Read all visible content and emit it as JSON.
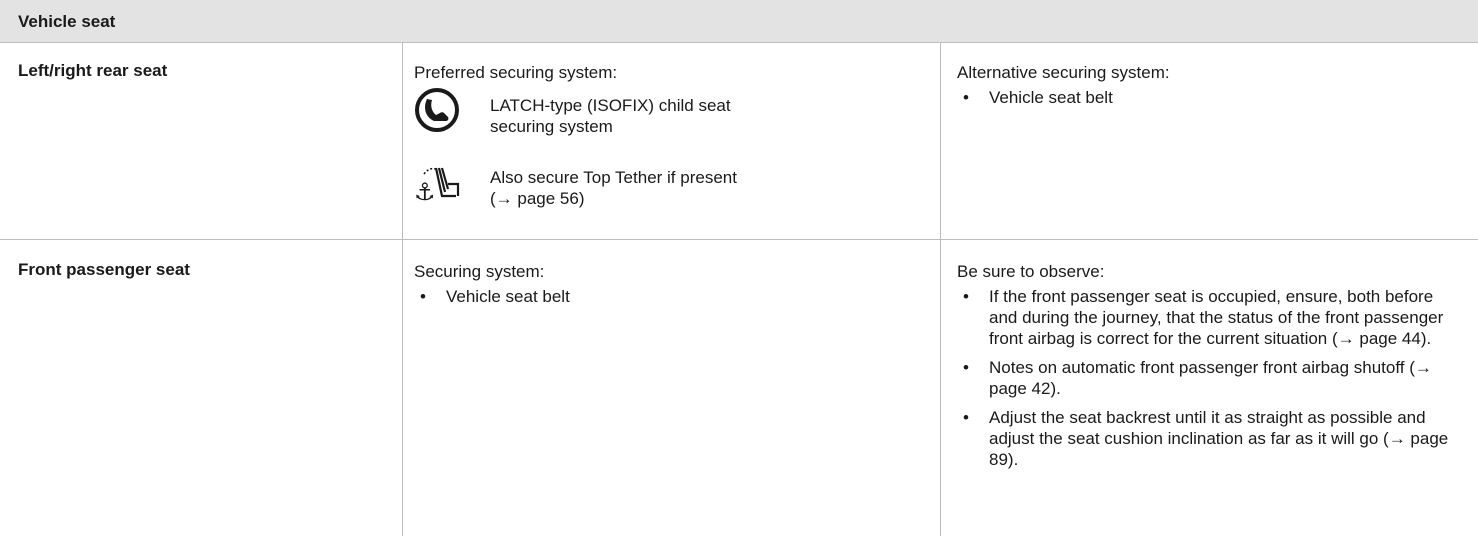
{
  "header": {
    "title": "Vehicle seat"
  },
  "rows": [
    {
      "label": "Left/right rear seat",
      "middle": {
        "lead": "Preferred securing system:",
        "icon_items": [
          {
            "icon": "isofix-child-seat-icon",
            "text": "LATCH-type (ISOFIX) child seat securing system"
          },
          {
            "icon": "top-tether-anchor-icon",
            "text": "Also secure Top Tether if present",
            "text2": "(→ page 56)"
          }
        ]
      },
      "right": {
        "lead": "Alternative securing system:",
        "bullets": [
          "Vehicle seat belt"
        ]
      }
    },
    {
      "label": "Front passenger seat",
      "middle": {
        "lead": "Securing system:",
        "bullets": [
          "Vehicle seat belt"
        ]
      },
      "right": {
        "lead": "Be sure to observe:",
        "bullets": [
          "If the front passenger seat is occupied, ensure, both before and during the journey, that the status of the front passenger front airbag is correct for the current situation (→ page 44).",
          "Notes on automatic front passenger front airbag shutoff (→ page 42).",
          "Adjust the seat backrest until it as straight as possible and adjust the seat cushion inclination as far as it will go (→ page 89)."
        ]
      }
    }
  ]
}
